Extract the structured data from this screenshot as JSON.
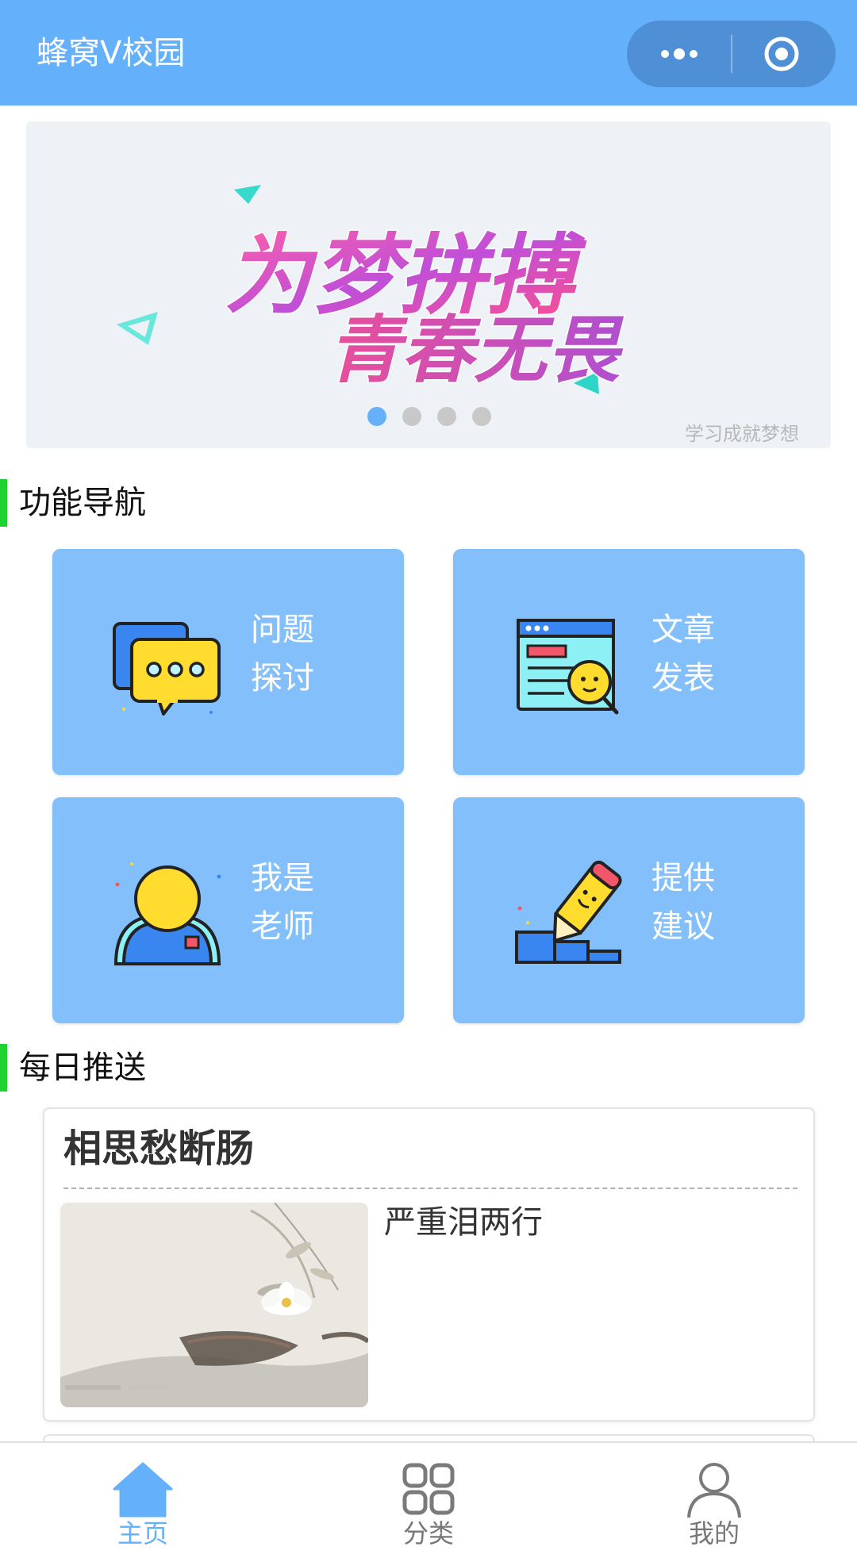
{
  "navbar": {
    "title": "蜂窝V校园",
    "more_icon": "more-dots-icon",
    "close_icon": "target-circle-icon",
    "background": "#64b0fb"
  },
  "banner": {
    "line1": "为梦拼搏",
    "line2": "青春无畏",
    "watermark": "学习成就梦想",
    "slide_count": 4,
    "active_slide": 1
  },
  "features": {
    "section_title": "功能导航",
    "accent": "#1fd131",
    "card_color": "#83c0fb",
    "items": [
      {
        "line1": "问题",
        "line2": "探讨",
        "icon": "chat-bubbles-icon"
      },
      {
        "line1": "文章",
        "line2": "发表",
        "icon": "browser-article-icon"
      },
      {
        "line1": "我是",
        "line2": "老师",
        "icon": "teacher-avatar-icon"
      },
      {
        "line1": "提供",
        "line2": "建议",
        "icon": "pencil-steps-icon"
      }
    ]
  },
  "daily": {
    "section_title": "每日推送",
    "post": {
      "title": "相思愁断肠",
      "excerpt": "严重泪两行"
    }
  },
  "tabbar": {
    "active_color": "#64b0fb",
    "items": [
      {
        "label": "主页",
        "icon": "home-icon"
      },
      {
        "label": "分类",
        "icon": "grid-icon"
      },
      {
        "label": "我的",
        "icon": "user-icon"
      }
    ]
  }
}
